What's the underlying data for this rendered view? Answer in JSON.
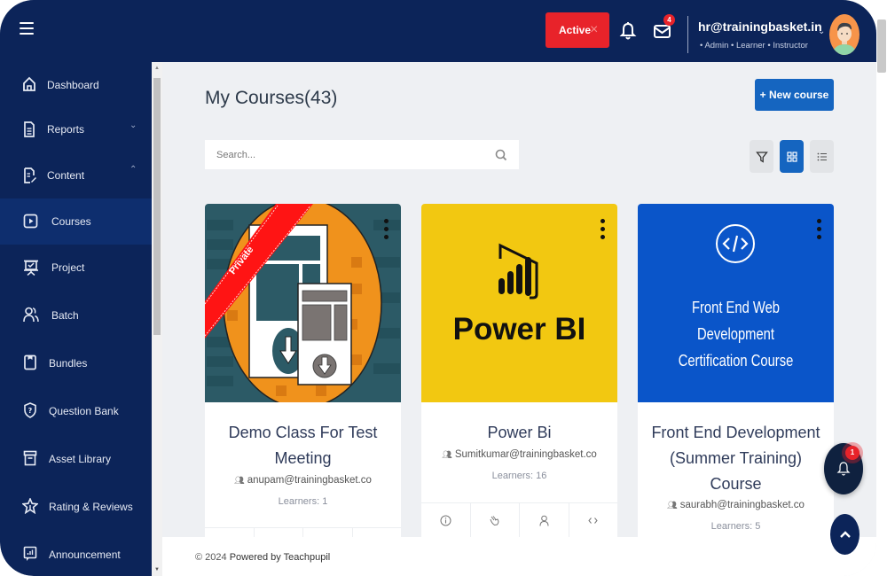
{
  "header": {
    "status_label": "Active",
    "status_close": "×",
    "mail_badge": "4",
    "user_email": "hr@trainingbasket.in",
    "user_roles": "• Admin • Learner • Instructor",
    "caret": "⌄"
  },
  "sidebar": {
    "items": [
      {
        "label": "Dashboard",
        "icon": "home-icon"
      },
      {
        "label": "Reports",
        "icon": "report-icon",
        "chevron": "⌄"
      },
      {
        "label": "Content",
        "icon": "content-icon",
        "chevron": "⌃"
      },
      {
        "label": "Courses",
        "icon": "play-icon",
        "selected": true
      },
      {
        "label": "Project",
        "icon": "presentation-icon"
      },
      {
        "label": "Batch",
        "icon": "users-icon"
      },
      {
        "label": "Bundles",
        "icon": "bookmark-icon"
      },
      {
        "label": "Question Bank",
        "icon": "shield-question-icon"
      },
      {
        "label": "Asset Library",
        "icon": "archive-icon"
      },
      {
        "label": "Rating & Reviews",
        "icon": "star-icon"
      },
      {
        "label": "Announcement",
        "icon": "chart-board-icon"
      }
    ]
  },
  "main": {
    "title": "My Courses(43)",
    "new_course_label": "+ New course",
    "search_placeholder": "Search...",
    "view_buttons": [
      {
        "name": "filter",
        "active": false
      },
      {
        "name": "grid",
        "active": true
      },
      {
        "name": "list",
        "active": false
      }
    ]
  },
  "courses": [
    {
      "title": "Demo Class For Test Meeting",
      "author": "anupam@trainingbasket.co",
      "learners": "Learners: 1",
      "ribbon": "Private",
      "image_colors": {
        "bg": "#2c5a66",
        "circle": "#f0921c"
      }
    },
    {
      "title": "Power Bi",
      "author": "Sumitkumar@trainingbasket.co",
      "learners": "Learners: 16",
      "image_text": "Power BI",
      "image_colors": {
        "bg": "#f2c811"
      }
    },
    {
      "title": "Front End Development (Summer Training) Course",
      "author": "saurabh@trainingbasket.co",
      "learners": "Learners: 5",
      "image_text_line1": "Front End Web Development",
      "image_text_line2": "Certification Course",
      "image_colors": {
        "bg": "#0a55c9"
      }
    }
  ],
  "card_actions": [
    "info",
    "edit",
    "user",
    "code"
  ],
  "footer": {
    "copyright": "© 2024",
    "powered": "Powered by Teachpupil"
  },
  "floating": {
    "notify_badge": "1"
  },
  "colors": {
    "navy": "#0c2459",
    "primary": "#1565c0",
    "danger": "#e8232a"
  }
}
